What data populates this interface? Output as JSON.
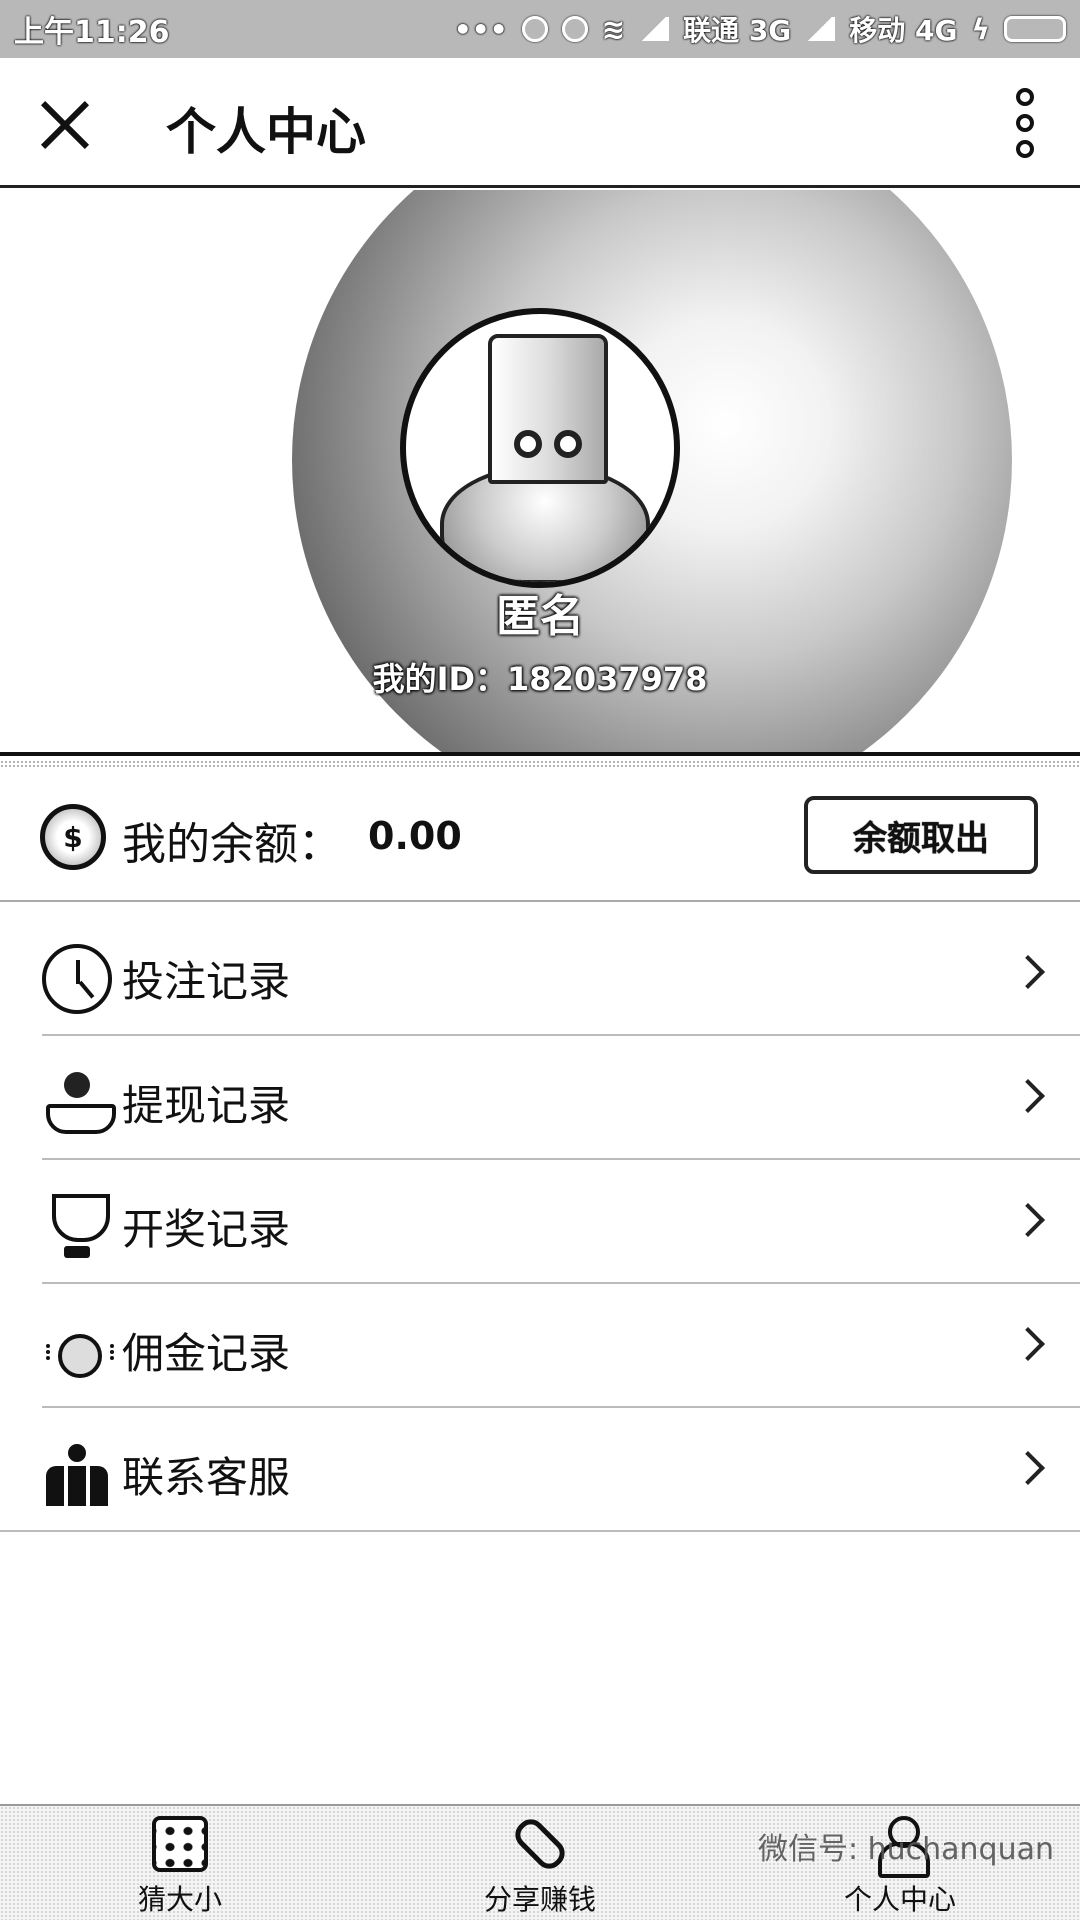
{
  "status_bar": {
    "time": "上午11:26",
    "carrier1": "联通 3G",
    "carrier2": "移动 4G"
  },
  "header": {
    "title": "个人中心"
  },
  "profile": {
    "nickname": "匿名",
    "user_id_text": "我的ID：182037978"
  },
  "balance": {
    "label": "我的余额：",
    "value": "0.00",
    "withdraw_label": "余额取出"
  },
  "menu": {
    "items": [
      {
        "label": "投注记录",
        "icon": "clock-icon"
      },
      {
        "label": "提现记录",
        "icon": "coin-hand-icon"
      },
      {
        "label": "开奖记录",
        "icon": "trophy-icon"
      },
      {
        "label": "佣金记录",
        "icon": "coin-icon"
      },
      {
        "label": "联系客服",
        "icon": "customer-service-icon"
      }
    ]
  },
  "tabbar": {
    "tabs": [
      {
        "label": "猜大小",
        "icon": "dice-icon"
      },
      {
        "label": "分享赚钱",
        "icon": "link-icon"
      },
      {
        "label": "个人中心",
        "icon": "person-icon"
      }
    ],
    "watermark": "微信号: huchanquan"
  }
}
